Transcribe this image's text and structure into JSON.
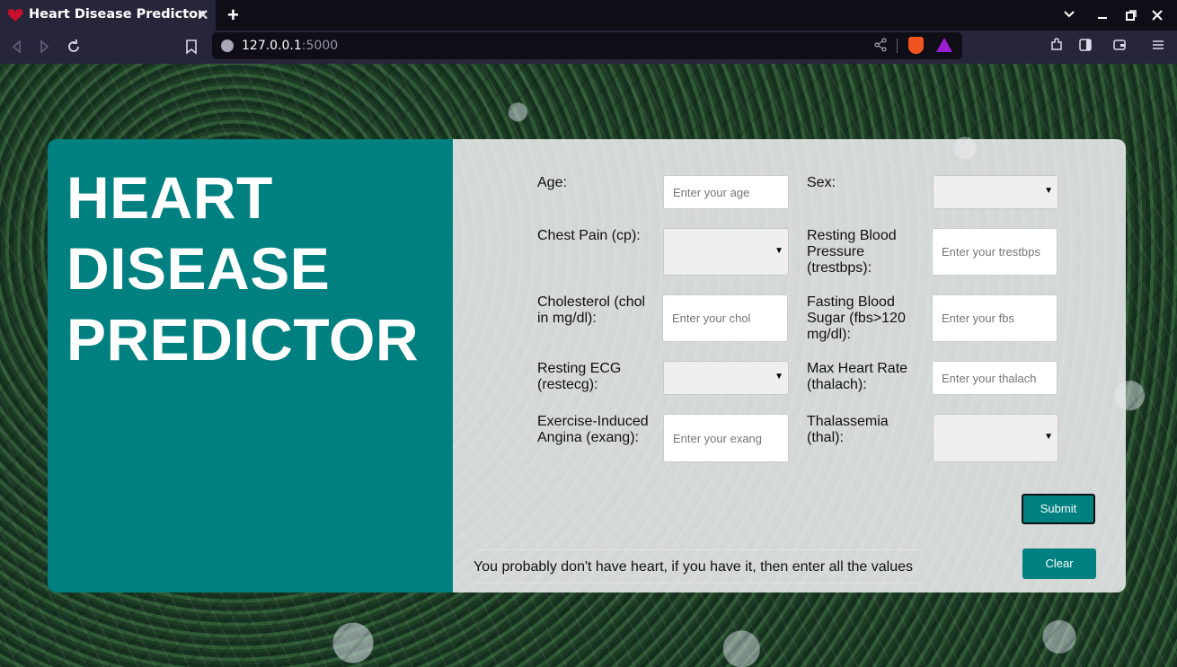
{
  "browser": {
    "tab_title": "Heart Disease Predictor",
    "tab_close": "✕",
    "new_tab": "+",
    "url_host": "127.0.0.1",
    "url_port": ":5000",
    "icons": [
      "back-icon",
      "forward-icon",
      "reload-icon",
      "bookmark-icon",
      "site-info-icon",
      "share-icon",
      "brave-shields-icon",
      "brave-rewards-icon",
      "extensions-icon",
      "sidebar-icon",
      "wallet-icon",
      "menu-icon"
    ]
  },
  "app": {
    "title_lines": [
      "HEART",
      "DISEASE",
      "PREDICTOR"
    ],
    "accent_color": "#008080",
    "fields": {
      "age": {
        "label": "Age:",
        "placeholder": "Enter your age"
      },
      "sex": {
        "label": "Sex:"
      },
      "cp": {
        "label": "Chest Pain (cp):"
      },
      "trestbps": {
        "label": "Resting Blood Pressure (trestbps):",
        "placeholder": "Enter your trestbps"
      },
      "chol": {
        "label": "Cholesterol (chol in mg/dl):",
        "placeholder": "Enter your chol"
      },
      "fbs": {
        "label": "Fasting Blood Sugar (fbs>120 mg/dl):",
        "placeholder": "Enter your fbs"
      },
      "restecg": {
        "label": "Resting ECG (restecg):"
      },
      "thalach": {
        "label": "Max Heart Rate (thalach):",
        "placeholder": "Enter your thalach"
      },
      "exang": {
        "label": "Exercise-Induced Angina (exang):",
        "placeholder": "Enter your exang"
      },
      "thal": {
        "label": "Thalassemia (thal):"
      }
    },
    "submit_label": "Submit",
    "clear_label": "Clear",
    "result_text": "You probably don't have heart, if you have it, then enter all the values"
  }
}
